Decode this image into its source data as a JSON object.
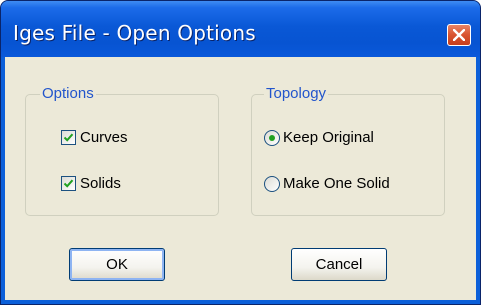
{
  "window": {
    "title": "Iges File - Open Options"
  },
  "options": {
    "group_title": "Options",
    "items": [
      {
        "label": "Curves",
        "checked": true
      },
      {
        "label": "Solids",
        "checked": true
      }
    ]
  },
  "topology": {
    "group_title": "Topology",
    "items": [
      {
        "label": "Keep Original",
        "selected": true
      },
      {
        "label": "Make One Solid",
        "selected": false
      }
    ]
  },
  "buttons": {
    "ok_label": "OK",
    "cancel_label": "Cancel"
  },
  "colors": {
    "title_bar": "#0a58d6",
    "close_button": "#d9532f",
    "client_bg": "#ece9d8",
    "group_title": "#2255cc",
    "radio_dot": "#21a121"
  }
}
